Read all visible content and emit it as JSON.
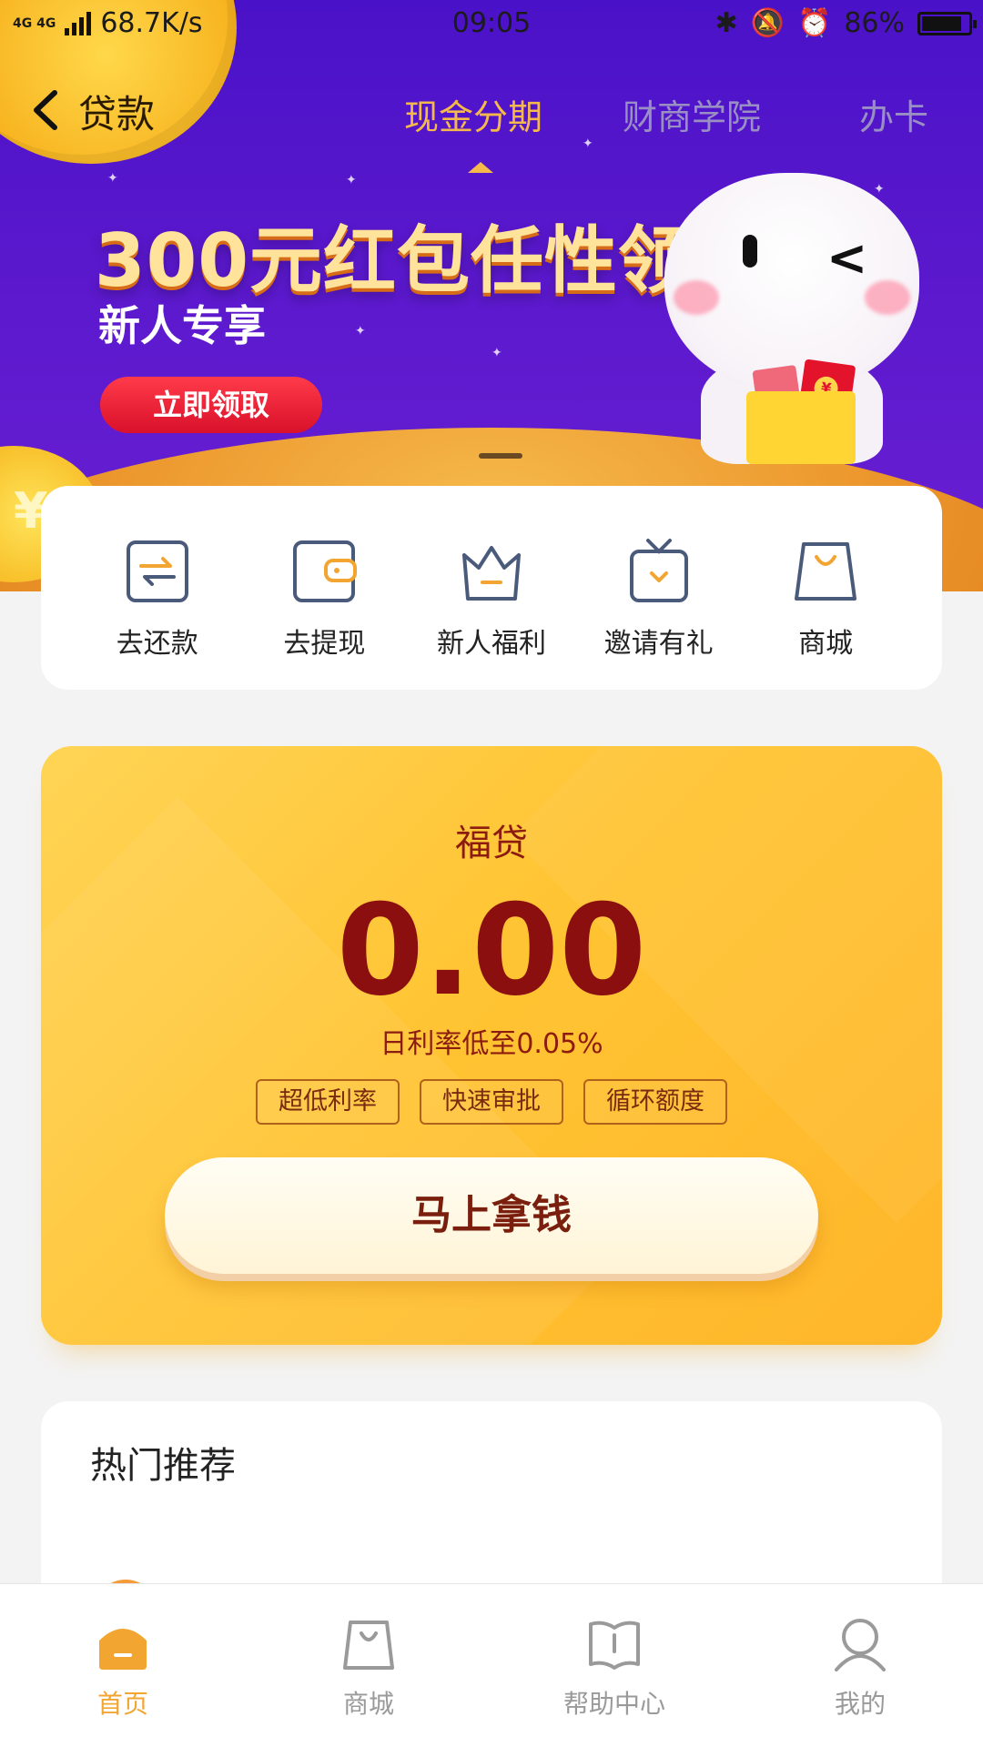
{
  "status_bar": {
    "network": "4G 4G",
    "speed": "68.7K/s",
    "time": "09:05",
    "battery": "86%",
    "battery_level": 0.86
  },
  "header": {
    "back_icon": "back-arrow-icon",
    "title": "贷款",
    "tabs": [
      {
        "label": "现金分期",
        "active": true
      },
      {
        "label": "财商学院",
        "active": false
      },
      {
        "label": "办卡",
        "active": false
      }
    ]
  },
  "banner": {
    "headline": "300元红包任性领",
    "subline": "新人专享",
    "cta": "立即领取"
  },
  "quick_actions": [
    {
      "label": "去还款",
      "icon": "repay-icon"
    },
    {
      "label": "去提现",
      "icon": "wallet-icon"
    },
    {
      "label": "新人福利",
      "icon": "crown-icon"
    },
    {
      "label": "邀请有礼",
      "icon": "gift-icon"
    },
    {
      "label": "商城",
      "icon": "shopping-bag-icon"
    }
  ],
  "loan_card": {
    "product_name": "福贷",
    "amount": "0.00",
    "rate_text": "日利率低至0.05%",
    "tags": [
      "超低利率",
      "快速审批",
      "循环额度"
    ],
    "cta": "马上拿钱"
  },
  "hot": {
    "title": "热门推荐"
  },
  "bottom_nav": [
    {
      "label": "首页",
      "icon": "home-icon",
      "active": true
    },
    {
      "label": "商城",
      "icon": "shopping-bag-icon",
      "active": false
    },
    {
      "label": "帮助中心",
      "icon": "help-book-icon",
      "active": false
    },
    {
      "label": "我的",
      "icon": "user-icon",
      "active": false
    }
  ],
  "colors": {
    "accent": "#f3a531",
    "hero_purple": "#5a18cc",
    "card_yellow": "#ffc433",
    "amount_red": "#8c0f0f"
  }
}
